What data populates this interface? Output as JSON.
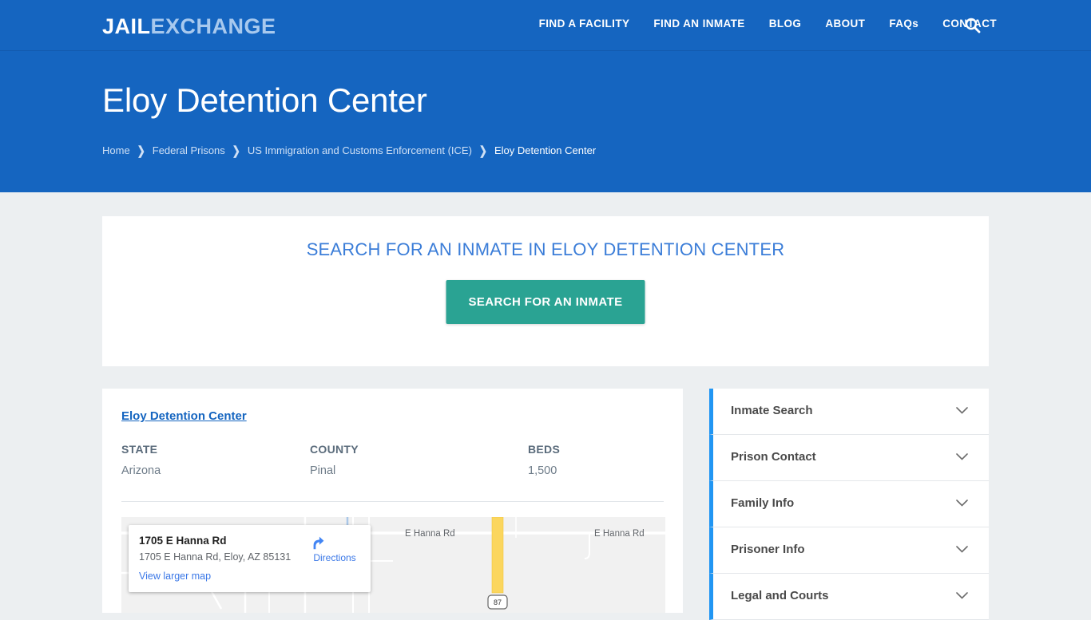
{
  "site": {
    "logo_primary": "JAIL",
    "logo_secondary": "EXCHANGE",
    "nav": [
      {
        "label": "FIND A FACILITY"
      },
      {
        "label": "FIND AN INMATE"
      },
      {
        "label": "BLOG"
      },
      {
        "label": "ABOUT"
      },
      {
        "label": "FAQs"
      },
      {
        "label": "CONTACT"
      }
    ],
    "search_icon": "search-icon",
    "colors": {
      "header_blue": "#1565c0",
      "accent_blue": "#2196f3",
      "teal_button": "#2aa393",
      "link_blue": "#3b7dd8",
      "page_background": "#eceff1"
    }
  },
  "hero": {
    "title": "Eloy Detention Center",
    "breadcrumb": [
      {
        "label": "Home",
        "current": false
      },
      {
        "label": "Federal Prisons",
        "current": false
      },
      {
        "label": "US Immigration and Customs Enforcement (ICE)",
        "current": false
      },
      {
        "label": "Eloy Detention Center",
        "current": true
      }
    ],
    "breadcrumb_separator": "❯"
  },
  "search_panel": {
    "heading": "SEARCH FOR AN INMATE IN ELOY DETENTION CENTER",
    "button_label": "SEARCH FOR AN INMATE"
  },
  "facility": {
    "name": "Eloy Detention Center",
    "fields": [
      {
        "label": "STATE",
        "value": "Arizona"
      },
      {
        "label": "COUNTY",
        "value": "Pinal"
      },
      {
        "label": "BEDS",
        "value": "1,500"
      }
    ]
  },
  "map": {
    "card": {
      "title": "1705 E Hanna Rd",
      "address": "1705 E Hanna Rd, Eloy, AZ 85131",
      "view_larger_label": "View larger map",
      "directions_label": "Directions",
      "directions_icon": "directions-arrow-icon"
    },
    "labels": {
      "street_left": "E Hanna Rd",
      "street_right": "E Hanna Rd",
      "highway_shield": "87"
    }
  },
  "sidebar": {
    "items": [
      {
        "label": "Inmate Search",
        "icon": "chevron-down-icon"
      },
      {
        "label": "Prison Contact",
        "icon": "chevron-down-icon"
      },
      {
        "label": "Family Info",
        "icon": "chevron-down-icon"
      },
      {
        "label": "Prisoner Info",
        "icon": "chevron-down-icon"
      },
      {
        "label": "Legal and Courts",
        "icon": "chevron-down-icon"
      }
    ]
  }
}
